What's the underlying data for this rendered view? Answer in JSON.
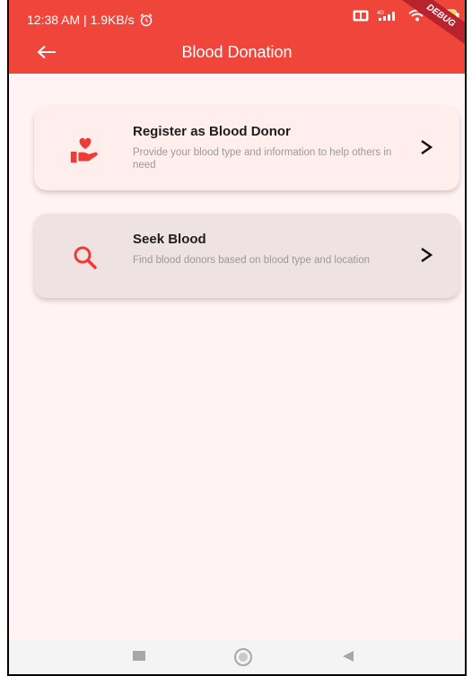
{
  "status_bar": {
    "time_speed": "12:38 AM | 1.9KB/s",
    "alarm_icon": "alarm-clock-icon",
    "network_label": "4G",
    "debug_label": "DEBUG"
  },
  "app_bar": {
    "title": "Blood Donation",
    "back_icon": "arrow-left-icon",
    "color": "#f0453a"
  },
  "cards": [
    {
      "title": "Register as Blood Donor",
      "subtitle": "Provide your blood type and information to help others in need",
      "icon": "hand-heart-icon",
      "background": "#ffeeec"
    },
    {
      "title": "Seek Blood",
      "subtitle": "Find blood donors based on blood type and location",
      "icon": "search-icon",
      "background": "#eee2e2"
    }
  ],
  "nav_bar": {
    "recent_icon": "square-icon",
    "home_icon": "circle-icon",
    "back_icon": "triangle-back-icon"
  }
}
